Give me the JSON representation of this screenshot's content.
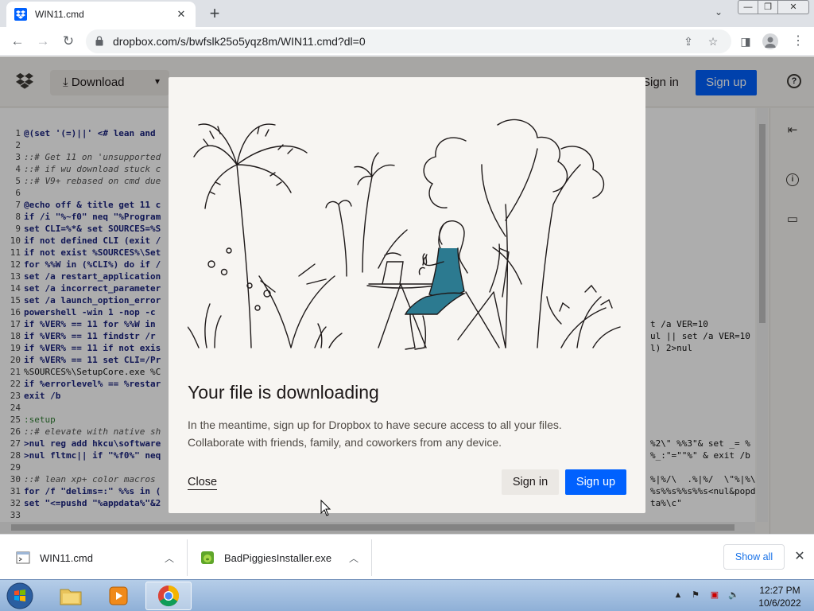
{
  "browser": {
    "tab_title": "WIN11.cmd",
    "url": "dropbox.com/s/bwfslk25o5yqz8m/WIN11.cmd?dl=0",
    "window_controls": {
      "minimize": "—",
      "maximize": "❐",
      "close": "✕"
    }
  },
  "dropbox_header": {
    "download_label": "Download",
    "signin_label": "Sign in",
    "signup_label": "Sign up"
  },
  "code_lines": [
    {
      "n": "1",
      "t": "@(set '(=)||' <# lean and"
    },
    {
      "n": "2",
      "t": ""
    },
    {
      "n": "3",
      "t": "::# Get 11 on 'unsupported"
    },
    {
      "n": "4",
      "t": "::# if wu download stuck c"
    },
    {
      "n": "5",
      "t": "::# V9+ rebased on cmd due"
    },
    {
      "n": "6",
      "t": ""
    },
    {
      "n": "7",
      "t": "@echo off & title get 11 c"
    },
    {
      "n": "8",
      "t": "if /i \"%~f0\" neq \"%Program"
    },
    {
      "n": "9",
      "t": "set CLI=%*& set SOURCES=%S"
    },
    {
      "n": "10",
      "t": "if not defined CLI (exit /"
    },
    {
      "n": "11",
      "t": "if not exist %SOURCES%\\Set"
    },
    {
      "n": "12",
      "t": "for %%W in (%CLI%) do if /"
    },
    {
      "n": "13",
      "t": "set /a restart_application"
    },
    {
      "n": "14",
      "t": "set /a incorrect_parameter"
    },
    {
      "n": "15",
      "t": "set /a launch_option_error"
    },
    {
      "n": "16",
      "t": "powershell -win 1 -nop -c"
    },
    {
      "n": "17",
      "t": "if %VER% == 11 for %%W in"
    },
    {
      "n": "18",
      "t": "if %VER% == 11 findstr /r"
    },
    {
      "n": "19",
      "t": "if %VER% == 11 if not exis"
    },
    {
      "n": "20",
      "t": "if %VER% == 11 set CLI=/Pr"
    },
    {
      "n": "21",
      "t": "%SOURCES%\\SetupCore.exe %C"
    },
    {
      "n": "22",
      "t": "if %errorlevel% == %restar"
    },
    {
      "n": "23",
      "t": "exit /b"
    },
    {
      "n": "24",
      "t": ""
    },
    {
      "n": "25",
      "t": ":setup"
    },
    {
      "n": "26",
      "t": "::# elevate with native sh"
    },
    {
      "n": "27",
      "t": ">nul reg add hkcu\\software"
    },
    {
      "n": "28",
      "t": ">nul fltmc|| if \"%f0%\" neq"
    },
    {
      "n": "29",
      "t": ""
    },
    {
      "n": "30",
      "t": "::# lean xp+ color macros"
    },
    {
      "n": "31",
      "t": "for /f \"delims=:\" %%s in ("
    },
    {
      "n": "32",
      "t": "set \"<=pushd \"%appdata%\"&2"
    },
    {
      "n": "33",
      "t": ""
    }
  ],
  "code_right_fragments": [
    {
      "line": "17",
      "t": "t /a VER=10"
    },
    {
      "line": "18",
      "t": "ul || set /a VER=10"
    },
    {
      "line": "19",
      "t": "l) 2>nul"
    },
    {
      "line": "27",
      "t": "%2\\\" %%3\"& set _= %"
    },
    {
      "line": "28",
      "t": "%_:\"=\"\"%\" & exit /b"
    },
    {
      "line": "30",
      "t": "%|%/\\  .%|%/  \\\"%|%\\"
    },
    {
      "line": "31",
      "t": "%s%%s%%s%%s<nul&popd"
    },
    {
      "line": "32",
      "t": "ta%\\c\""
    }
  ],
  "modal": {
    "title": "Your file is downloading",
    "body_line1": "In the meantime, sign up for Dropbox to have secure access to all your files.",
    "body_line2": "Collaborate with friends, family, and coworkers from any device.",
    "close_label": "Close",
    "signin_label": "Sign in",
    "signup_label": "Sign up"
  },
  "downloads": {
    "items": [
      {
        "name": "WIN11.cmd"
      },
      {
        "name": "BadPiggiesInstaller.exe"
      }
    ],
    "show_all_label": "Show all"
  },
  "taskbar": {
    "time": "12:27 PM",
    "date": "10/6/2022"
  },
  "colors": {
    "dropbox_blue": "#0061fe",
    "modal_bg": "#f7f5f2",
    "chrome_link_blue": "#1a73e8"
  }
}
